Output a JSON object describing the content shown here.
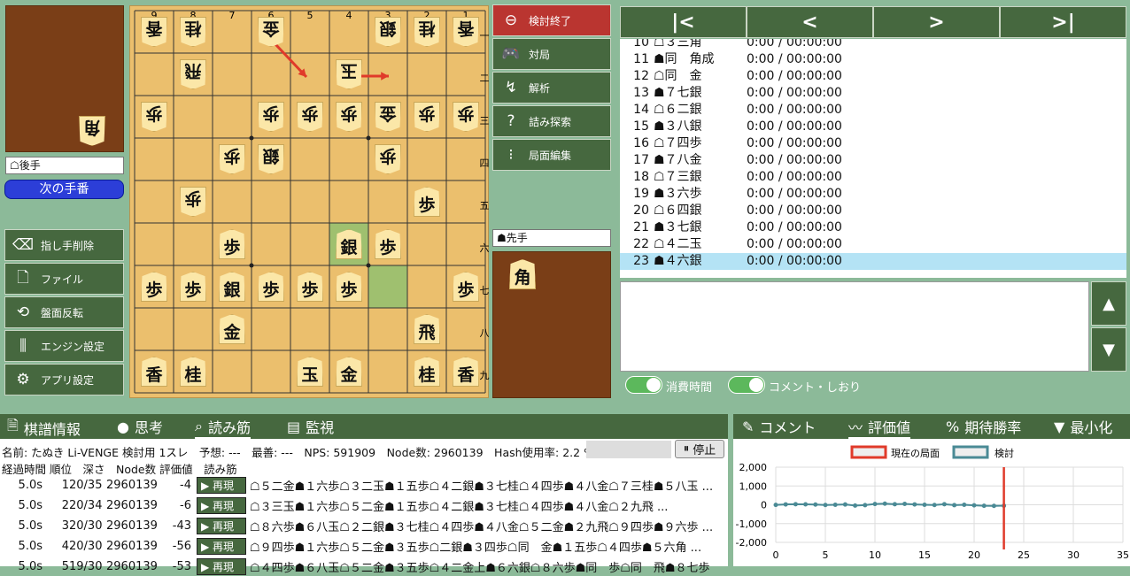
{
  "board": {
    "files": [
      "9",
      "8",
      "7",
      "6",
      "5",
      "4",
      "3",
      "2",
      "1"
    ],
    "ranks": [
      "一",
      "二",
      "三",
      "四",
      "五",
      "六",
      "七",
      "八",
      "九"
    ],
    "pieces": [
      {
        "f": 9,
        "r": 1,
        "c": "香",
        "g": true
      },
      {
        "f": 8,
        "r": 1,
        "c": "桂",
        "g": true
      },
      {
        "f": 6,
        "r": 1,
        "c": "金",
        "g": true
      },
      {
        "f": 3,
        "r": 1,
        "c": "銀",
        "g": true
      },
      {
        "f": 2,
        "r": 1,
        "c": "桂",
        "g": true
      },
      {
        "f": 1,
        "r": 1,
        "c": "香",
        "g": true
      },
      {
        "f": 8,
        "r": 2,
        "c": "飛",
        "g": true
      },
      {
        "f": 4,
        "r": 2,
        "c": "玉",
        "g": true
      },
      {
        "f": 9,
        "r": 3,
        "c": "歩",
        "g": true
      },
      {
        "f": 6,
        "r": 3,
        "c": "歩",
        "g": true
      },
      {
        "f": 5,
        "r": 3,
        "c": "歩",
        "g": true
      },
      {
        "f": 4,
        "r": 3,
        "c": "歩",
        "g": true
      },
      {
        "f": 3,
        "r": 3,
        "c": "金",
        "g": true
      },
      {
        "f": 2,
        "r": 3,
        "c": "歩",
        "g": true
      },
      {
        "f": 1,
        "r": 3,
        "c": "歩",
        "g": true
      },
      {
        "f": 7,
        "r": 4,
        "c": "歩",
        "g": true
      },
      {
        "f": 6,
        "r": 4,
        "c": "銀",
        "g": true
      },
      {
        "f": 3,
        "r": 4,
        "c": "歩",
        "g": true
      },
      {
        "f": 8,
        "r": 5,
        "c": "歩",
        "g": true
      },
      {
        "f": 2,
        "r": 5,
        "c": "歩",
        "g": false
      },
      {
        "f": 7,
        "r": 6,
        "c": "歩",
        "g": false
      },
      {
        "f": 4,
        "r": 6,
        "c": "銀",
        "g": false
      },
      {
        "f": 3,
        "r": 6,
        "c": "歩",
        "g": false
      },
      {
        "f": 9,
        "r": 7,
        "c": "歩",
        "g": false
      },
      {
        "f": 8,
        "r": 7,
        "c": "歩",
        "g": false
      },
      {
        "f": 7,
        "r": 7,
        "c": "銀",
        "g": false
      },
      {
        "f": 6,
        "r": 7,
        "c": "歩",
        "g": false
      },
      {
        "f": 5,
        "r": 7,
        "c": "歩",
        "g": false
      },
      {
        "f": 4,
        "r": 7,
        "c": "歩",
        "g": false
      },
      {
        "f": 1,
        "r": 7,
        "c": "歩",
        "g": false
      },
      {
        "f": 7,
        "r": 8,
        "c": "金",
        "g": false
      },
      {
        "f": 2,
        "r": 8,
        "c": "飛",
        "g": false
      },
      {
        "f": 9,
        "r": 9,
        "c": "香",
        "g": false
      },
      {
        "f": 8,
        "r": 9,
        "c": "桂",
        "g": false
      },
      {
        "f": 5,
        "r": 9,
        "c": "玉",
        "g": false
      },
      {
        "f": 4,
        "r": 9,
        "c": "金",
        "g": false
      },
      {
        "f": 2,
        "r": 9,
        "c": "桂",
        "g": false
      },
      {
        "f": 1,
        "r": 9,
        "c": "香",
        "g": false
      }
    ],
    "highlights": [
      {
        "f": 4,
        "r": 6
      },
      {
        "f": 3,
        "r": 7
      }
    ]
  },
  "gote": {
    "label": "☖後手",
    "hand": [
      "角"
    ]
  },
  "sente": {
    "label": "☗先手",
    "hand": [
      "角"
    ]
  },
  "next_turn_label": "次の手番",
  "left_buttons": [
    {
      "label": "指し手削除",
      "icon": "delete-icon"
    },
    {
      "label": "ファイル",
      "icon": "file-icon"
    },
    {
      "label": "盤面反転",
      "icon": "flip-icon"
    },
    {
      "label": "エンジン設定",
      "icon": "sliders-icon"
    },
    {
      "label": "アプリ設定",
      "icon": "gear-icon"
    }
  ],
  "mid_buttons": [
    {
      "label": "検討終了",
      "icon": "minus-circle-icon"
    },
    {
      "label": "対局",
      "icon": "gamepad-icon"
    },
    {
      "label": "解析",
      "icon": "analysis-icon"
    },
    {
      "label": "詰み探索",
      "icon": "question-icon"
    },
    {
      "label": "局面編集",
      "icon": "edit-board-icon"
    }
  ],
  "moves": [
    {
      "n": "10",
      "m": "☖３三角",
      "t": "0:00 / 00:00:00"
    },
    {
      "n": "11",
      "m": "☗同　角成",
      "t": "0:00 / 00:00:00"
    },
    {
      "n": "12",
      "m": "☖同　金",
      "t": "0:00 / 00:00:00"
    },
    {
      "n": "13",
      "m": "☗７七銀",
      "t": "0:00 / 00:00:00"
    },
    {
      "n": "14",
      "m": "☖６二銀",
      "t": "0:00 / 00:00:00"
    },
    {
      "n": "15",
      "m": "☗３八銀",
      "t": "0:00 / 00:00:00"
    },
    {
      "n": "16",
      "m": "☖７四歩",
      "t": "0:00 / 00:00:00"
    },
    {
      "n": "17",
      "m": "☗７八金",
      "t": "0:00 / 00:00:00"
    },
    {
      "n": "18",
      "m": "☖７三銀",
      "t": "0:00 / 00:00:00"
    },
    {
      "n": "19",
      "m": "☗３六歩",
      "t": "0:00 / 00:00:00"
    },
    {
      "n": "20",
      "m": "☖６四銀",
      "t": "0:00 / 00:00:00"
    },
    {
      "n": "21",
      "m": "☗３七銀",
      "t": "0:00 / 00:00:00"
    },
    {
      "n": "22",
      "m": "☖４二玉",
      "t": "0:00 / 00:00:00"
    },
    {
      "n": "23",
      "m": "☗４六銀",
      "t": "0:00 / 00:00:00"
    }
  ],
  "toggles": {
    "time": "消費時間",
    "comment": "コメント・しおり"
  },
  "tabs_left": [
    {
      "label": "棋譜情報",
      "icon": "doc-icon"
    },
    {
      "label": "思考",
      "icon": "brain-icon"
    },
    {
      "label": "読み筋",
      "icon": "search-list-icon"
    },
    {
      "label": "監視",
      "icon": "monitor-icon"
    }
  ],
  "tabs_right": [
    {
      "label": "コメント",
      "icon": "comment-icon"
    },
    {
      "label": "評価値",
      "icon": "chart-icon"
    },
    {
      "label": "期待勝率",
      "icon": "percent-icon"
    },
    {
      "label": "最小化",
      "icon": "triangle-down-icon"
    }
  ],
  "engine": {
    "status": "名前: たぬき Li-VENGE 検討用 1スレ　予想: ---　最善: ---　NPS: 591909　Node数: 2960139　Hash使用率: 2.2 %",
    "stop": "停止",
    "header": "経過時間 順位　深さ　Node数 評価値　読み筋",
    "play": "▶ 再現",
    "rows": [
      {
        "time": "5.0s",
        "rank": "1",
        "depth": "20/35",
        "nodes": "2960139",
        "score": "-4",
        "pv": "☖５二金☗１六歩☖３二玉☗１五歩☖４二銀☗３七桂☖４四歩☗４八金☖７三桂☗５八玉 ..."
      },
      {
        "time": "5.0s",
        "rank": "2",
        "depth": "20/34",
        "nodes": "2960139",
        "score": "-6",
        "pv": "☖３三玉☗１六歩☖５二金☗１五歩☖４二銀☗３七桂☖４四歩☗４八金☖２九飛 ..."
      },
      {
        "time": "5.0s",
        "rank": "3",
        "depth": "20/30",
        "nodes": "2960139",
        "score": "-43",
        "pv": "☖８六歩☗６八玉☖２二銀☗３七桂☖４四歩☗４八金☖５二金☗２九飛☖９四歩☗９六歩 ..."
      },
      {
        "time": "5.0s",
        "rank": "4",
        "depth": "20/30",
        "nodes": "2960139",
        "score": "-56",
        "pv": "☖９四歩☗１六歩☖５二金☗３五歩☖二銀☗３四歩☖同　金☗１五歩☖４四歩☗５六角 ..."
      },
      {
        "time": "5.0s",
        "rank": "5",
        "depth": "19/30",
        "nodes": "2960139",
        "score": "-53",
        "pv": "☖４四歩☗６八玉☖５二金☗３五歩☖４二金上☗６六銀☖８六歩☗同　歩☖同　飛☗８七歩"
      }
    ]
  },
  "chart_data": {
    "type": "line",
    "legend": [
      "現在の局面",
      "検討"
    ],
    "yticks": [
      "2,000",
      "1,000",
      "0",
      "-1,000",
      "-2,000"
    ],
    "xticks": [
      "0",
      "5",
      "10",
      "15",
      "20",
      "25",
      "30",
      "35"
    ],
    "xlim": [
      0,
      35
    ],
    "ylim": [
      -2000,
      2000
    ],
    "series": [
      {
        "name": "検討",
        "x": [
          0,
          1,
          2,
          3,
          4,
          5,
          6,
          7,
          8,
          9,
          10,
          11,
          12,
          13,
          14,
          15,
          16,
          17,
          18,
          19,
          20,
          21,
          22,
          23
        ],
        "values": [
          -5,
          20,
          30,
          25,
          10,
          -10,
          0,
          15,
          -40,
          -20,
          40,
          60,
          30,
          45,
          20,
          0,
          -10,
          30,
          -20,
          0,
          -30,
          -55,
          -60,
          -50
        ]
      }
    ],
    "current": 23
  },
  "colors": {
    "accent": "#b4e3f5",
    "red": "#ba3530",
    "green": "#46683f"
  }
}
